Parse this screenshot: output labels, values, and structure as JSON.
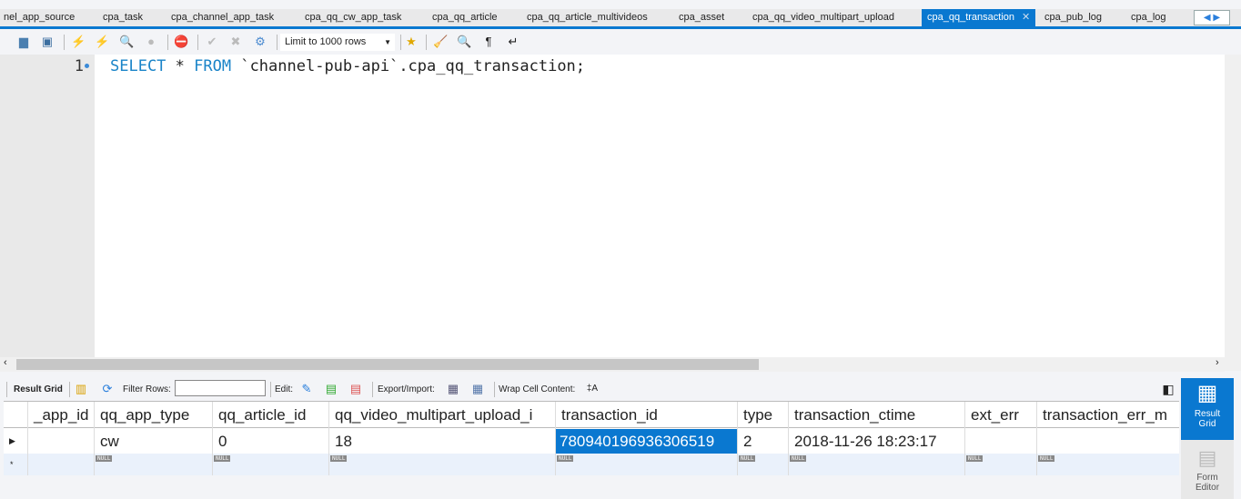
{
  "tabs": [
    "nel_app_source",
    "cpa_task",
    "cpa_channel_app_task",
    "cpa_qq_cw_app_task",
    "cpa_qq_article",
    "cpa_qq_article_multivideos",
    "cpa_asset",
    "cpa_qq_video_multipart_upload",
    "cpa_qq_transaction",
    "cpa_pub_log",
    "cpa_log"
  ],
  "active_tab": "cpa_qq_transaction",
  "toolbar": {
    "limit": "Limit to 1000 rows"
  },
  "editor": {
    "line": "1",
    "sql_kw1": "SELECT",
    "sql_mid": " * ",
    "sql_kw2": "FROM",
    "sql_rest": " `channel-pub-api`.cpa_qq_transaction;"
  },
  "result_toolbar": {
    "result_grid": "Result Grid",
    "filter_rows": "Filter Rows:",
    "edit": "Edit:",
    "export_import": "Export/Import:",
    "wrap": "Wrap Cell Content:"
  },
  "grid": {
    "columns": [
      "_app_id",
      "qq_app_type",
      "qq_article_id",
      "qq_video_multipart_upload_i",
      "transaction_id",
      "type",
      "transaction_ctime",
      "ext_err",
      "transaction_err_m"
    ],
    "row": [
      "",
      "cw",
      "0",
      "18",
      "780940196936306519",
      "2",
      "2018-11-26 18:23:17",
      "",
      ""
    ],
    "null_label": "NULL"
  },
  "side": {
    "result_grid": "Result Grid",
    "form_editor": "Form Editor"
  }
}
